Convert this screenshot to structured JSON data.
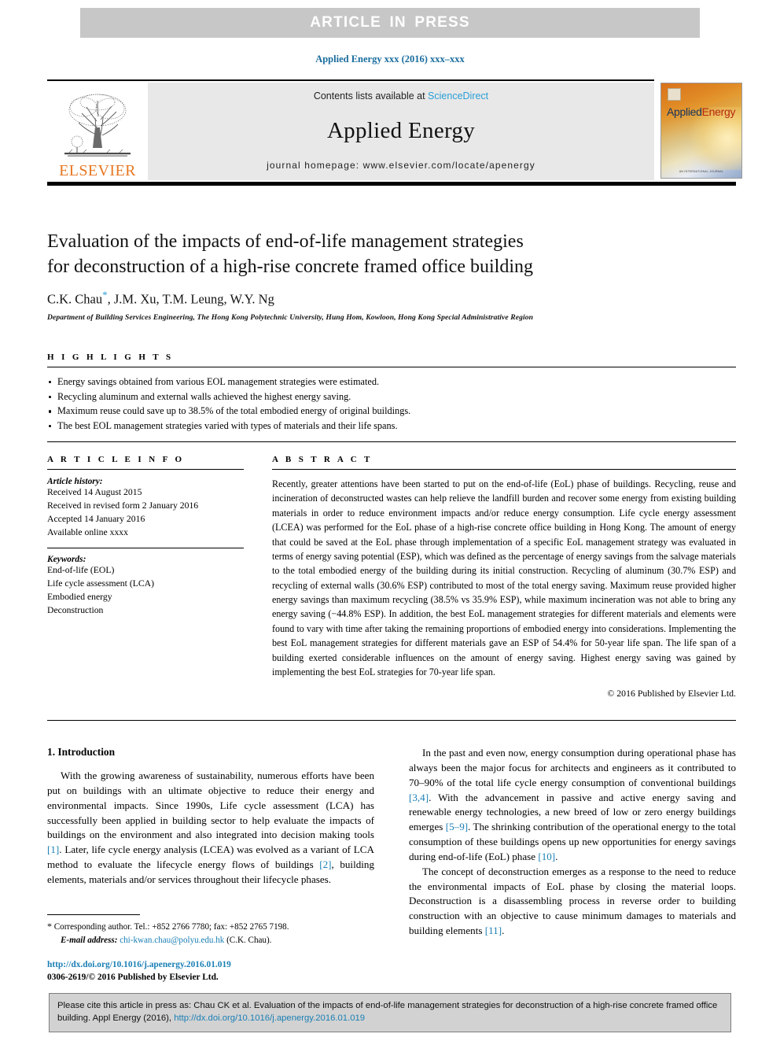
{
  "banner": {
    "text": "ARTICLE  IN  PRESS"
  },
  "running_head": "Applied Energy xxx (2016) xxx–xxx",
  "masthead": {
    "contents_prefix": "Contents lists available at ",
    "sciencedirect": "ScienceDirect",
    "journal_name": "Applied Energy",
    "homepage": "journal homepage: www.elsevier.com/locate/apenergy",
    "publisher_logo_text": "ELSEVIER",
    "cover_title_a": "Applied",
    "cover_title_b": "Energy",
    "cover_footer": "AN INTERNATIONAL JOURNAL"
  },
  "article": {
    "title_line1": "Evaluation of the impacts of end-of-life management strategies",
    "title_line2": "for deconstruction of a high-rise concrete framed office building",
    "authors": "C.K. Chau",
    "authors_rest": ", J.M. Xu, T.M. Leung, W.Y. Ng",
    "corresponding_marker": "*",
    "affiliation": "Department of Building Services Engineering, The Hong Kong Polytechnic University, Hung Hom, Kowloon, Hong Kong Special Administrative Region"
  },
  "highlights": {
    "label": "H I G H L I G H T S",
    "items": [
      "Energy savings obtained from various EOL management strategies were estimated.",
      "Recycling aluminum and external walls achieved the highest energy saving.",
      "Maximum reuse could save up to 38.5% of the total embodied energy of original buildings.",
      "The best EOL management strategies varied with types of materials and their life spans."
    ]
  },
  "article_info": {
    "label": "A R T I C L E    I N F O",
    "history_label": "Article history:",
    "history": [
      "Received 14 August 2015",
      "Received in revised form 2 January 2016",
      "Accepted 14 January 2016",
      "Available online xxxx"
    ],
    "keywords_label": "Keywords:",
    "keywords": [
      "End-of-life (EOL)",
      "Life cycle assessment (LCA)",
      "Embodied energy",
      "Deconstruction"
    ]
  },
  "abstract": {
    "label": "A B S T R A C T",
    "text": "Recently, greater attentions have been started to put on the end-of-life (EoL) phase of buildings. Recycling, reuse and incineration of deconstructed wastes can help relieve the landfill burden and recover some energy from existing building materials in order to reduce environment impacts and/or reduce energy consumption. Life cycle energy assessment (LCEA) was performed for the EoL phase of a high-rise concrete office building in Hong Kong. The amount of energy that could be saved at the EoL phase through implementation of a specific EoL management strategy was evaluated in terms of energy saving potential (ESP), which was defined as the percentage of energy savings from the salvage materials to the total embodied energy of the building during its initial construction. Recycling of aluminum (30.7% ESP) and recycling of external walls (30.6% ESP) contributed to most of the total energy saving. Maximum reuse provided higher energy savings than maximum recycling (38.5% vs 35.9% ESP), while maximum incineration was not able to bring any energy saving (−44.8% ESP). In addition, the best EoL management strategies for different materials and elements were found to vary with time after taking the remaining proportions of embodied energy into considerations. Implementing the best EoL management strategies for different materials gave an ESP of 54.4% for 50-year life span. The life span of a building exerted considerable influences on the amount of energy saving. Highest energy saving was gained by implementing the best EoL strategies for 70-year life span.",
    "copyright": "© 2016 Published by Elsevier Ltd."
  },
  "body": {
    "section_heading": "1. Introduction",
    "left_para_1_a": "With the growing awareness of sustainability, numerous efforts have been put on buildings with an ultimate objective to reduce their energy and environmental impacts. Since 1990s, Life cycle assessment (LCA) has successfully been applied in building sector to help evaluate the impacts of buildings on the environment and also integrated into decision making tools ",
    "left_ref_1": "[1]",
    "left_para_1_b": ". Later, life cycle energy analysis (LCEA) was evolved as a variant of LCA method to evaluate the lifecycle energy flows of buildings ",
    "left_ref_2": "[2]",
    "left_para_1_c": ", building elements, materials and/or services throughout their lifecycle phases.",
    "right_para_1_a": "In the past and even now, energy consumption during operational phase has always been the major focus for architects and engineers as it contributed to 70–90% of the total life cycle energy consumption of conventional buildings ",
    "right_ref_34": "[3,4]",
    "right_para_1_b": ". With the advancement in passive and active energy saving and renewable energy technologies, a new breed of low or zero energy buildings emerges ",
    "right_ref_59": "[5–9]",
    "right_para_1_c": ". The shrinking contribution of the operational energy to the total consumption of these buildings opens up new opportunities for energy savings during end-of-life (EoL) phase ",
    "right_ref_10": "[10]",
    "right_para_1_d": ".",
    "right_para_2_a": "The concept of deconstruction emerges as a response to the need to reduce the environmental impacts of EoL phase by closing the material loops. Deconstruction is a disassembling process in reverse order to building construction with an objective to cause minimum damages to materials and building elements ",
    "right_ref_11": "[11]",
    "right_para_2_b": "."
  },
  "footnote": {
    "star": "*",
    "corresponding": " Corresponding author. Tel.: +852 2766 7780; fax: +852 2765 7198.",
    "email_label": "E-mail address:",
    "email": "chi-kwan.chau@polyu.edu.hk",
    "email_owner": " (C.K. Chau)."
  },
  "doi_block": {
    "doi": "http://dx.doi.org/10.1016/j.apenergy.2016.01.019",
    "issn": "0306-2619/© 2016 Published by Elsevier Ltd."
  },
  "cite_box": {
    "text_a": "Please cite this article in press as: Chau CK et al. Evaluation of the impacts of end-of-life management strategies for deconstruction of a high-rise concrete framed office building. Appl Energy (2016), ",
    "link": "http://dx.doi.org/10.1016/j.apenergy.2016.01.019"
  },
  "colors": {
    "link": "#1a7fb5",
    "sciencedirect": "#2a9fd6",
    "elsevier_orange": "#e87722",
    "banner_bg": "#c7c7c7",
    "cite_bg": "#d2d2d2"
  }
}
